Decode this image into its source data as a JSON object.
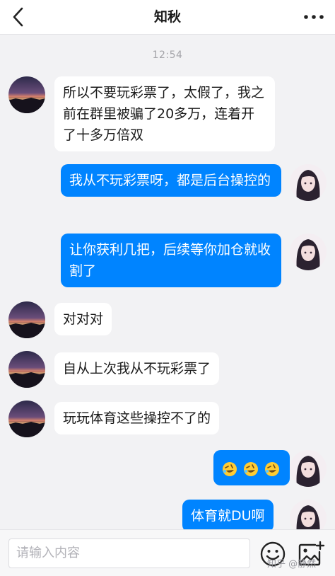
{
  "header": {
    "title": "知秋"
  },
  "timestamp": "12:54",
  "messages": [
    {
      "text": "所以不要玩彩票了，太假了，我之前在群里被骗了20多万，连着开了十多万倍双"
    },
    {
      "text": "我从不玩彩票呀，都是后台操控的"
    },
    {
      "text": "让你获利几把，后续等你加仓就收割了"
    },
    {
      "text": "对对对"
    },
    {
      "text": "自从上次我从不玩彩票了"
    },
    {
      "text": "玩玩体育这些操控不了的"
    },
    {
      "emoji_count": 3,
      "emoji": "rolling-on-floor-laughing"
    },
    {
      "text": "体育就DU啊"
    }
  ],
  "input": {
    "placeholder": "请输入内容"
  },
  "watermark": "知乎 @静然",
  "colors": {
    "outgoing": "#0084ff",
    "incoming": "#ffffff",
    "background": "#f2f2f4"
  }
}
